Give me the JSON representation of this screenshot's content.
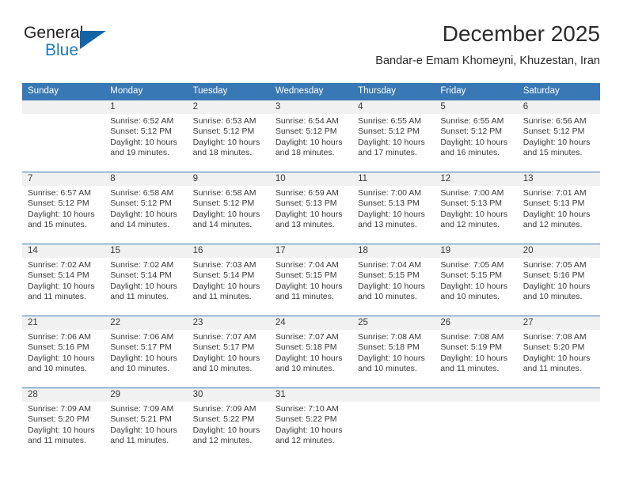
{
  "brand": {
    "name_top": "General",
    "name_bottom": "Blue",
    "accent_color": "#1464a5",
    "blue_text_color": "#1f7bc1"
  },
  "header": {
    "title": "December 2025",
    "subtitle": "Bandar-e Emam Khomeyni, Khuzestan, Iran"
  },
  "calendar": {
    "header_bg": "#3878b4",
    "daynum_bg": "#f1f1f1",
    "weekday_headers": [
      "Sunday",
      "Monday",
      "Tuesday",
      "Wednesday",
      "Thursday",
      "Friday",
      "Saturday"
    ],
    "weeks": [
      [
        {
          "day": "",
          "blank": true,
          "sunrise": "",
          "sunset": "",
          "daylight_line1": "",
          "daylight_line2": ""
        },
        {
          "day": "1",
          "sunrise": "Sunrise: 6:52 AM",
          "sunset": "Sunset: 5:12 PM",
          "daylight_line1": "Daylight: 10 hours",
          "daylight_line2": "and 19 minutes."
        },
        {
          "day": "2",
          "sunrise": "Sunrise: 6:53 AM",
          "sunset": "Sunset: 5:12 PM",
          "daylight_line1": "Daylight: 10 hours",
          "daylight_line2": "and 18 minutes."
        },
        {
          "day": "3",
          "sunrise": "Sunrise: 6:54 AM",
          "sunset": "Sunset: 5:12 PM",
          "daylight_line1": "Daylight: 10 hours",
          "daylight_line2": "and 18 minutes."
        },
        {
          "day": "4",
          "sunrise": "Sunrise: 6:55 AM",
          "sunset": "Sunset: 5:12 PM",
          "daylight_line1": "Daylight: 10 hours",
          "daylight_line2": "and 17 minutes."
        },
        {
          "day": "5",
          "sunrise": "Sunrise: 6:55 AM",
          "sunset": "Sunset: 5:12 PM",
          "daylight_line1": "Daylight: 10 hours",
          "daylight_line2": "and 16 minutes."
        },
        {
          "day": "6",
          "sunrise": "Sunrise: 6:56 AM",
          "sunset": "Sunset: 5:12 PM",
          "daylight_line1": "Daylight: 10 hours",
          "daylight_line2": "and 15 minutes."
        }
      ],
      [
        {
          "day": "7",
          "sunrise": "Sunrise: 6:57 AM",
          "sunset": "Sunset: 5:12 PM",
          "daylight_line1": "Daylight: 10 hours",
          "daylight_line2": "and 15 minutes."
        },
        {
          "day": "8",
          "sunrise": "Sunrise: 6:58 AM",
          "sunset": "Sunset: 5:12 PM",
          "daylight_line1": "Daylight: 10 hours",
          "daylight_line2": "and 14 minutes."
        },
        {
          "day": "9",
          "sunrise": "Sunrise: 6:58 AM",
          "sunset": "Sunset: 5:12 PM",
          "daylight_line1": "Daylight: 10 hours",
          "daylight_line2": "and 14 minutes."
        },
        {
          "day": "10",
          "sunrise": "Sunrise: 6:59 AM",
          "sunset": "Sunset: 5:13 PM",
          "daylight_line1": "Daylight: 10 hours",
          "daylight_line2": "and 13 minutes."
        },
        {
          "day": "11",
          "sunrise": "Sunrise: 7:00 AM",
          "sunset": "Sunset: 5:13 PM",
          "daylight_line1": "Daylight: 10 hours",
          "daylight_line2": "and 13 minutes."
        },
        {
          "day": "12",
          "sunrise": "Sunrise: 7:00 AM",
          "sunset": "Sunset: 5:13 PM",
          "daylight_line1": "Daylight: 10 hours",
          "daylight_line2": "and 12 minutes."
        },
        {
          "day": "13",
          "sunrise": "Sunrise: 7:01 AM",
          "sunset": "Sunset: 5:13 PM",
          "daylight_line1": "Daylight: 10 hours",
          "daylight_line2": "and 12 minutes."
        }
      ],
      [
        {
          "day": "14",
          "sunrise": "Sunrise: 7:02 AM",
          "sunset": "Sunset: 5:14 PM",
          "daylight_line1": "Daylight: 10 hours",
          "daylight_line2": "and 11 minutes."
        },
        {
          "day": "15",
          "sunrise": "Sunrise: 7:02 AM",
          "sunset": "Sunset: 5:14 PM",
          "daylight_line1": "Daylight: 10 hours",
          "daylight_line2": "and 11 minutes."
        },
        {
          "day": "16",
          "sunrise": "Sunrise: 7:03 AM",
          "sunset": "Sunset: 5:14 PM",
          "daylight_line1": "Daylight: 10 hours",
          "daylight_line2": "and 11 minutes."
        },
        {
          "day": "17",
          "sunrise": "Sunrise: 7:04 AM",
          "sunset": "Sunset: 5:15 PM",
          "daylight_line1": "Daylight: 10 hours",
          "daylight_line2": "and 11 minutes."
        },
        {
          "day": "18",
          "sunrise": "Sunrise: 7:04 AM",
          "sunset": "Sunset: 5:15 PM",
          "daylight_line1": "Daylight: 10 hours",
          "daylight_line2": "and 10 minutes."
        },
        {
          "day": "19",
          "sunrise": "Sunrise: 7:05 AM",
          "sunset": "Sunset: 5:15 PM",
          "daylight_line1": "Daylight: 10 hours",
          "daylight_line2": "and 10 minutes."
        },
        {
          "day": "20",
          "sunrise": "Sunrise: 7:05 AM",
          "sunset": "Sunset: 5:16 PM",
          "daylight_line1": "Daylight: 10 hours",
          "daylight_line2": "and 10 minutes."
        }
      ],
      [
        {
          "day": "21",
          "sunrise": "Sunrise: 7:06 AM",
          "sunset": "Sunset: 5:16 PM",
          "daylight_line1": "Daylight: 10 hours",
          "daylight_line2": "and 10 minutes."
        },
        {
          "day": "22",
          "sunrise": "Sunrise: 7:06 AM",
          "sunset": "Sunset: 5:17 PM",
          "daylight_line1": "Daylight: 10 hours",
          "daylight_line2": "and 10 minutes."
        },
        {
          "day": "23",
          "sunrise": "Sunrise: 7:07 AM",
          "sunset": "Sunset: 5:17 PM",
          "daylight_line1": "Daylight: 10 hours",
          "daylight_line2": "and 10 minutes."
        },
        {
          "day": "24",
          "sunrise": "Sunrise: 7:07 AM",
          "sunset": "Sunset: 5:18 PM",
          "daylight_line1": "Daylight: 10 hours",
          "daylight_line2": "and 10 minutes."
        },
        {
          "day": "25",
          "sunrise": "Sunrise: 7:08 AM",
          "sunset": "Sunset: 5:18 PM",
          "daylight_line1": "Daylight: 10 hours",
          "daylight_line2": "and 10 minutes."
        },
        {
          "day": "26",
          "sunrise": "Sunrise: 7:08 AM",
          "sunset": "Sunset: 5:19 PM",
          "daylight_line1": "Daylight: 10 hours",
          "daylight_line2": "and 11 minutes."
        },
        {
          "day": "27",
          "sunrise": "Sunrise: 7:08 AM",
          "sunset": "Sunset: 5:20 PM",
          "daylight_line1": "Daylight: 10 hours",
          "daylight_line2": "and 11 minutes."
        }
      ],
      [
        {
          "day": "28",
          "sunrise": "Sunrise: 7:09 AM",
          "sunset": "Sunset: 5:20 PM",
          "daylight_line1": "Daylight: 10 hours",
          "daylight_line2": "and 11 minutes."
        },
        {
          "day": "29",
          "sunrise": "Sunrise: 7:09 AM",
          "sunset": "Sunset: 5:21 PM",
          "daylight_line1": "Daylight: 10 hours",
          "daylight_line2": "and 11 minutes."
        },
        {
          "day": "30",
          "sunrise": "Sunrise: 7:09 AM",
          "sunset": "Sunset: 5:22 PM",
          "daylight_line1": "Daylight: 10 hours",
          "daylight_line2": "and 12 minutes."
        },
        {
          "day": "31",
          "sunrise": "Sunrise: 7:10 AM",
          "sunset": "Sunset: 5:22 PM",
          "daylight_line1": "Daylight: 10 hours",
          "daylight_line2": "and 12 minutes."
        },
        {
          "day": "",
          "blank": true,
          "sunrise": "",
          "sunset": "",
          "daylight_line1": "",
          "daylight_line2": ""
        },
        {
          "day": "",
          "blank": true,
          "sunrise": "",
          "sunset": "",
          "daylight_line1": "",
          "daylight_line2": ""
        },
        {
          "day": "",
          "blank": true,
          "sunrise": "",
          "sunset": "",
          "daylight_line1": "",
          "daylight_line2": ""
        }
      ]
    ]
  }
}
